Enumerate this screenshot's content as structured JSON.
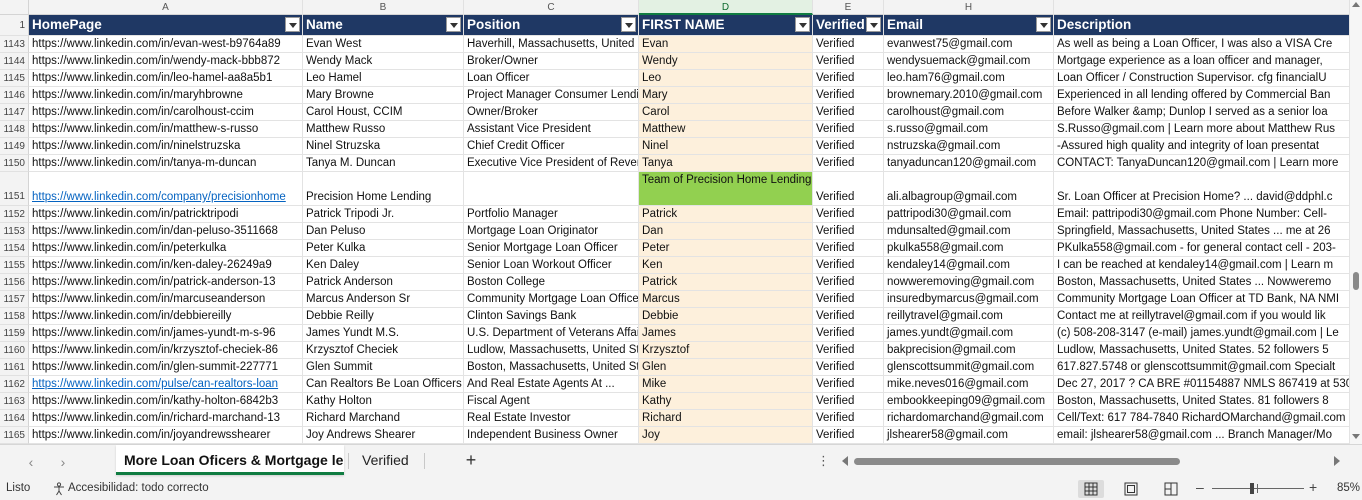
{
  "columns": [
    {
      "letter": "A",
      "header": "HomePage"
    },
    {
      "letter": "B",
      "header": "Name"
    },
    {
      "letter": "C",
      "header": "Position"
    },
    {
      "letter": "D",
      "header": "FIRST NAME"
    },
    {
      "letter": "E",
      "header": "Verified"
    },
    {
      "letter": "H",
      "header": "Email"
    },
    {
      "letter": "",
      "header": "Description"
    }
  ],
  "header_row_number": "1",
  "rows": [
    {
      "n": "1143",
      "a": "https://www.linkedin.com/in/evan-west-b9764a89",
      "b": "Evan West",
      "c": "Haverhill, Massachusetts, United States",
      "d": "Evan",
      "e": "Verified",
      "h": "evanwest75@gmail.com",
      "i": "As well as being a Loan Officer, I was also a VISA Cre"
    },
    {
      "n": "1144",
      "a": "https://www.linkedin.com/in/wendy-mack-bbb872",
      "b": "Wendy Mack",
      "c": "Broker/Owner",
      "d": "Wendy",
      "e": "Verified",
      "h": "wendysuemack@gmail.com",
      "i": "Mortgage experience as a loan officer and manager,"
    },
    {
      "n": "1145",
      "a": "https://www.linkedin.com/in/leo-hamel-aa8a5b1",
      "b": "Leo Hamel",
      "c": "Loan Officer",
      "d": "Leo",
      "e": "Verified",
      "h": "leo.ham76@gmail.com",
      "i": "Loan Officer / Construction Supervisor. cfg financialU"
    },
    {
      "n": "1146",
      "a": "https://www.linkedin.com/in/maryhbrowne",
      "b": "Mary Browne",
      "c": "Project Manager Consumer Lending",
      "d": "Mary",
      "e": "Verified",
      "h": "brownemary.2010@gmail.com",
      "i": "Experienced in all lending offered by Commercial Ban"
    },
    {
      "n": "1147",
      "a": "https://www.linkedin.com/in/carolhoust-ccim",
      "b": "Carol Houst, CCIM",
      "c": "Owner/Broker",
      "d": "Carol",
      "e": "Verified",
      "h": "carolhoust@gmail.com",
      "i": "Before Walker &amp; Dunlop I served as a senior loa"
    },
    {
      "n": "1148",
      "a": "https://www.linkedin.com/in/matthew-s-russo",
      "b": "Matthew Russo",
      "c": "Assistant Vice President",
      "d": "Matthew",
      "e": "Verified",
      "h": "s.russo@gmail.com",
      "i": "S.Russo@gmail.com | Learn more about Matthew Rus"
    },
    {
      "n": "1149",
      "a": "https://www.linkedin.com/in/ninelstruzska",
      "b": "Ninel Struzska",
      "c": "Chief Credit Officer",
      "d": "Ninel",
      "e": "Verified",
      "h": "nstruzska@gmail.com",
      "i": "-Assured high quality and integrity of loan presentat"
    },
    {
      "n": "1150",
      "a": "https://www.linkedin.com/in/tanya-m-duncan",
      "b": "Tanya M. Duncan",
      "c": "Executive Vice President of Revenue",
      "d": "Tanya",
      "e": "Verified",
      "h": "tanyaduncan120@gmail.com",
      "i": "CONTACT: TanyaDuncan120@gmail.com | Learn more"
    },
    {
      "n": "1151",
      "a": "https://www.linkedin.com/company/precisionhome",
      "b": "Precision Home Lending",
      "c": "",
      "d": "Team of Precision Home Lending",
      "e": "Verified",
      "h": "ali.albagroup@gmail.com",
      "i": "Sr. Loan Officer at Precision Home? ... david@ddphl.c"
    },
    {
      "n": "1152",
      "a": "https://www.linkedin.com/in/patricktripodi",
      "b": "Patrick Tripodi Jr.",
      "c": "Portfolio Manager",
      "d": "Patrick",
      "e": "Verified",
      "h": "pattripodi30@gmail.com",
      "i": "Email: pattripodi30@gmail.com Phone Number: Cell-"
    },
    {
      "n": "1153",
      "a": "https://www.linkedin.com/in/dan-peluso-3511668",
      "b": "Dan Peluso",
      "c": "Mortgage Loan Originator",
      "d": "Dan",
      "e": "Verified",
      "h": "mdunsalted@gmail.com",
      "i": "Springfield, Massachusetts, United States ... me at 26"
    },
    {
      "n": "1154",
      "a": "https://www.linkedin.com/in/peterkulka",
      "b": "Peter Kulka",
      "c": "Senior Mortgage Loan Officer",
      "d": "Peter",
      "e": "Verified",
      "h": "pkulka558@gmail.com",
      "i": "PKulka558@gmail.com - for general contact cell - 203-"
    },
    {
      "n": "1155",
      "a": "https://www.linkedin.com/in/ken-daley-26249a9",
      "b": "Ken Daley",
      "c": "Senior Loan Workout Officer",
      "d": "Ken",
      "e": "Verified",
      "h": "kendaley14@gmail.com",
      "i": "I can be reached at kendaley14@gmail.com | Learn m"
    },
    {
      "n": "1156",
      "a": "https://www.linkedin.com/in/patrick-anderson-13",
      "b": "Patrick Anderson",
      "c": "Boston College",
      "d": "Patrick",
      "e": "Verified",
      "h": "nowweremoving@gmail.com",
      "i": "Boston, Massachusetts, United States ... Nowweremo"
    },
    {
      "n": "1157",
      "a": "https://www.linkedin.com/in/marcuseanderson",
      "b": "Marcus Anderson Sr",
      "c": "Community Mortgage Loan Officer",
      "d": "Marcus",
      "e": "Verified",
      "h": "insuredbymarcus@gmail.com",
      "i": "Community Mortgage Loan Officer at TD Bank, NA NMI"
    },
    {
      "n": "1158",
      "a": "https://www.linkedin.com/in/debbiereilly",
      "b": "Debbie Reilly",
      "c": "Clinton Savings Bank",
      "d": "Debbie",
      "e": "Verified",
      "h": "reillytravel@gmail.com",
      "i": "Contact me at reillytravel@gmail.com if you would lik"
    },
    {
      "n": "1159",
      "a": "https://www.linkedin.com/in/james-yundt-m-s-96",
      "b": "James Yundt M.S.",
      "c": "U.S. Department of Veterans Affairs",
      "d": "James",
      "e": "Verified",
      "h": "james.yundt@gmail.com",
      "i": "(c) 508-208-3147 (e-mail) james.yundt@gmail.com | Le"
    },
    {
      "n": "1160",
      "a": "https://www.linkedin.com/in/krzysztof-checiek-86",
      "b": "Krzysztof Checiek",
      "c": "Ludlow, Massachusetts, United States",
      "d": "Krzysztof",
      "e": "Verified",
      "h": "bakprecision@gmail.com",
      "i": "Ludlow, Massachusetts, United States. 52 followers 5"
    },
    {
      "n": "1161",
      "a": "https://www.linkedin.com/in/glen-summit-227771",
      "b": "Glen Summit",
      "c": "Boston, Massachusetts, United States",
      "d": "Glen",
      "e": "Verified",
      "h": "glenscottsummit@gmail.com",
      "i": "617.827.5748 or glenscottsummit@gmail.com Specialt"
    },
    {
      "n": "1162",
      "a": "https://www.linkedin.com/pulse/can-realtors-loan",
      "b": "Can Realtors Be Loan Officers",
      "c": "And Real Estate Agents At ...",
      "d": "Mike",
      "e": "Verified",
      "h": "mike.neves016@gmail.com",
      "i": "Dec 27, 2017 ? CA BRE #01154887 NMLS 867419 at 530-2"
    },
    {
      "n": "1163",
      "a": "https://www.linkedin.com/in/kathy-holton-6842b3",
      "b": "Kathy Holton",
      "c": "Fiscal Agent",
      "d": "Kathy",
      "e": "Verified",
      "h": "embookkeeping09@gmail.com",
      "i": "Boston, Massachusetts, United States. 81 followers 8"
    },
    {
      "n": "1164",
      "a": "https://www.linkedin.com/in/richard-marchand-13",
      "b": "Richard Marchand",
      "c": "Real Estate Investor",
      "d": "Richard",
      "e": "Verified",
      "h": "richardomarchand@gmail.com",
      "i": "Cell/Text: 617 784-7840 RichardOMarchand@gmail.com"
    },
    {
      "n": "1165",
      "a": "https://www.linkedin.com/in/joyandrewsshearer",
      "b": "Joy Andrews Shearer",
      "c": "Independent Business Owner",
      "d": "Joy",
      "e": "Verified",
      "h": "jlshearer58@gmail.com",
      "i": "email: jlshearer58@gmail.com ... Branch Manager/Mo"
    }
  ],
  "sheet_tabs": [
    {
      "label": "More Loan Oficers & Mortgage len",
      "active": true
    },
    {
      "label": "Verified",
      "active": false
    }
  ],
  "status": {
    "ready": "Listo",
    "accessibility": "Accesibilidad: todo correcto",
    "zoom_minus": "–",
    "zoom_plus": "+",
    "zoom": "85%"
  },
  "colors": {
    "header_bg": "#1f3864",
    "first_name_fill": "#fdf0dc",
    "highlight_green": "#92d050",
    "link": "#0563c1",
    "accent": "#107c41"
  }
}
